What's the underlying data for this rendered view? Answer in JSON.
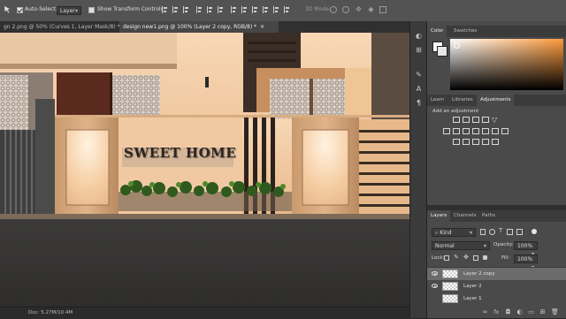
{
  "options_bar": {
    "auto_select_label": "Auto-Select:",
    "auto_select_checked": true,
    "target_value": "Layer",
    "show_transform_label": "Show Transform Controls",
    "show_transform_checked": false,
    "mode_3d_label": "3D Mode:"
  },
  "tabs": [
    {
      "label": "gn 2.png @ 50% (Curves 1, Layer Mask/8) *",
      "active": false
    },
    {
      "label": "design new1.png @ 100% (Layer 2 copy, RGB/8) *",
      "active": true
    }
  ],
  "close_glyph": "×",
  "canvas_text": "SWEET HOME",
  "status": {
    "doc_size": "Doc: 5.27M/10.4M"
  },
  "panels": {
    "color_tabs": [
      "Color",
      "Swatches"
    ],
    "adjust_tabs": [
      "Learn",
      "Libraries",
      "Adjustments"
    ],
    "add_adjustment": "Add an adjustment",
    "layer_tabs": [
      "Layers",
      "Channels",
      "Paths"
    ],
    "kind_value": "Kind",
    "blend_value": "Normal",
    "opacity_label": "Opacity:",
    "opacity_value": "100%",
    "lock_label": "Lock:",
    "fill_label": "Fill:",
    "fill_value": "100%"
  },
  "layers": [
    {
      "name": "Layer 2 copy",
      "selected": true,
      "visible": true
    },
    {
      "name": "Layer 2",
      "selected": false,
      "visible": true
    },
    {
      "name": "Layer 1",
      "selected": false,
      "visible": false
    }
  ],
  "icons": {
    "footer": [
      "link-icon",
      "fx-icon",
      "mask-icon",
      "adjustment-icon",
      "group-icon",
      "new-layer-icon",
      "trash-icon"
    ],
    "tools": [
      "color-sampler-icon",
      "history-icon",
      "brush-preset-icon",
      "character-icon",
      "paragraph-icon"
    ]
  },
  "colors": {
    "selected_layer": "#6b6b6b",
    "panel_bg": "#4a4a4a",
    "wall_beige": "#f2c9a3",
    "sign_text": "#2b2622"
  }
}
